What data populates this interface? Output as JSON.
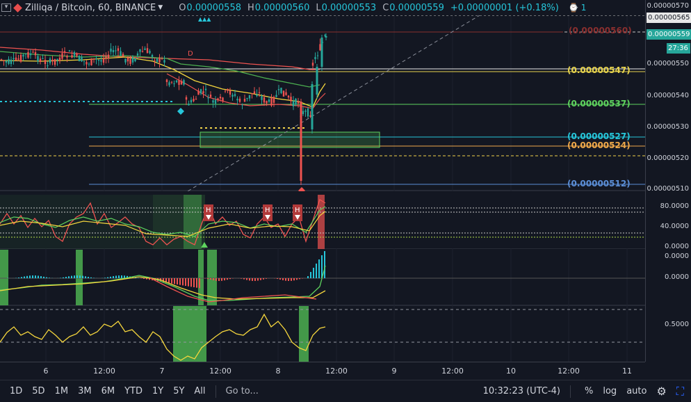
{
  "header": {
    "symbol_title": "Zilliqa / Bitcoin, 60, BINANCE",
    "ohlc": [
      {
        "key": "O",
        "value": "0.00000558"
      },
      {
        "key": "H",
        "value": "0.00000560"
      },
      {
        "key": "L",
        "value": "0.00000553"
      },
      {
        "key": "C",
        "value": "0.00000559"
      }
    ],
    "change": "+0.00000001 (+0.18%)",
    "indicator_count": "1"
  },
  "price_axis": {
    "labels": [
      "0.00000570",
      "0.00000560",
      "0.00000550",
      "0.00000540",
      "0.00000530",
      "0.00000520",
      "0.00000510"
    ],
    "top_label": "0.00000565",
    "current_price": "0.00000559",
    "countdown": "27:36",
    "rsi_labels": [
      "80.0000",
      "40.0000",
      "0.0000"
    ],
    "macd_labels": [
      "0.0000",
      "0.0000"
    ],
    "stoch_label": "0.5000"
  },
  "level_labels": {
    "red": "(0.00000560)",
    "yellow": "(0.00000547)",
    "green": "(0.00000537)",
    "cyan": "(0.00000527)",
    "orange": "(0.00000524)",
    "blue": "(0.00000512)"
  },
  "chart_labels": {
    "d_marker": "D",
    "h_markers": [
      "H",
      "H",
      "H"
    ]
  },
  "time_axis": {
    "labels": [
      "6",
      "12:00",
      "7",
      "12:00",
      "8",
      "12:00",
      "9",
      "12:00",
      "10",
      "12:00",
      "11"
    ]
  },
  "bottom_bar": {
    "ranges": [
      "1D",
      "5D",
      "1M",
      "3M",
      "6M",
      "YTD",
      "1Y",
      "5Y",
      "All"
    ],
    "goto": "Go to...",
    "clock": "10:32:23 (UTC-4)",
    "percent": "%",
    "log": "log",
    "auto": "auto"
  },
  "colors": {
    "background": "#131722",
    "up": "#26a69a",
    "down": "#ef5350",
    "accent": "#2962ff",
    "ma_red": "#ef5350",
    "ma_green": "#4caf50",
    "ma_yellow": "#f5d63d",
    "level_yellow": "#e8d44d",
    "level_green": "#5ed35e",
    "level_cyan": "#26c6da",
    "level_orange": "#f0a94a",
    "level_blue": "#5b8ed6"
  }
}
